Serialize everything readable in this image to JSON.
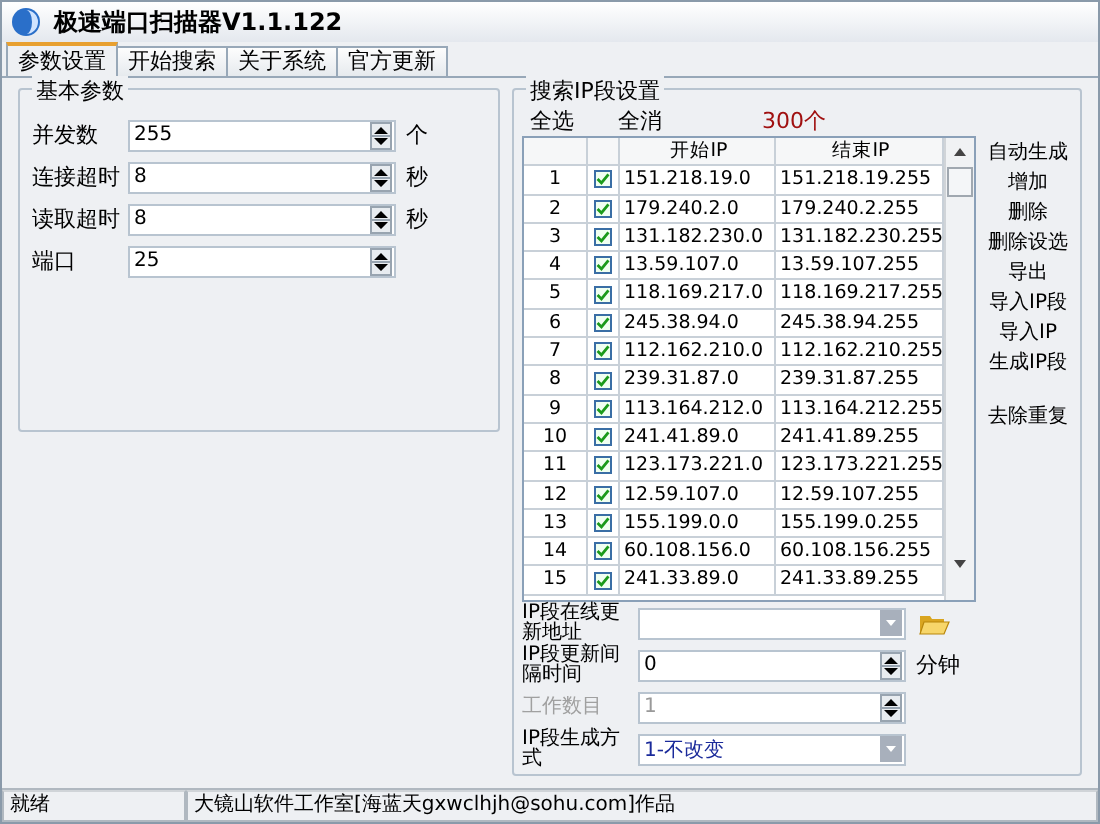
{
  "window": {
    "title": "极速端口扫描器V1.1.122"
  },
  "tabs": [
    {
      "label": "参数设置",
      "selected": true
    },
    {
      "label": "开始搜索",
      "selected": false
    },
    {
      "label": "关于系统",
      "selected": false
    },
    {
      "label": "官方更新",
      "selected": false
    }
  ],
  "basic_params": {
    "title": "基本参数",
    "fields": [
      {
        "label": "并发数",
        "value": "255",
        "unit": "个"
      },
      {
        "label": "连接超时",
        "value": "8",
        "unit": "秒"
      },
      {
        "label": "读取超时",
        "value": "8",
        "unit": "秒"
      },
      {
        "label": "端口",
        "value": "25"
      }
    ]
  },
  "ip_settings": {
    "title": "搜索IP段设置",
    "select_all": "全选",
    "deselect_all": "全消",
    "count": "300个",
    "table": {
      "columns": [
        "开始IP",
        "结束IP"
      ],
      "rows": [
        {
          "index": "1",
          "checked": true,
          "start": "151.218.19.0",
          "end": "151.218.19.255"
        },
        {
          "index": "2",
          "checked": true,
          "start": "179.240.2.0",
          "end": "179.240.2.255"
        },
        {
          "index": "3",
          "checked": true,
          "start": "131.182.230.0",
          "end": "131.182.230.255"
        },
        {
          "index": "4",
          "checked": true,
          "start": "13.59.107.0",
          "end": "13.59.107.255"
        },
        {
          "index": "5",
          "checked": true,
          "start": "118.169.217.0",
          "end": "118.169.217.255"
        },
        {
          "index": "6",
          "checked": true,
          "start": "245.38.94.0",
          "end": "245.38.94.255"
        },
        {
          "index": "7",
          "checked": true,
          "start": "112.162.210.0",
          "end": "112.162.210.255"
        },
        {
          "index": "8",
          "checked": true,
          "start": "239.31.87.0",
          "end": "239.31.87.255"
        },
        {
          "index": "9",
          "checked": true,
          "start": "113.164.212.0",
          "end": "113.164.212.255"
        },
        {
          "index": "10",
          "checked": true,
          "start": "241.41.89.0",
          "end": "241.41.89.255"
        },
        {
          "index": "11",
          "checked": true,
          "start": "123.173.221.0",
          "end": "123.173.221.255"
        },
        {
          "index": "12",
          "checked": true,
          "start": "12.59.107.0",
          "end": "12.59.107.255"
        },
        {
          "index": "13",
          "checked": true,
          "start": "155.199.0.0",
          "end": "155.199.0.255"
        },
        {
          "index": "14",
          "checked": true,
          "start": "60.108.156.0",
          "end": "60.108.156.255"
        },
        {
          "index": "15",
          "checked": true,
          "start": "241.33.89.0",
          "end": "241.33.89.255"
        }
      ]
    },
    "action_groups": [
      [
        "自动生成",
        "增加",
        "删除",
        "删除设选",
        "导出",
        "导入IP段",
        "导入IP",
        "生成IP段"
      ],
      [
        "去除重复"
      ]
    ],
    "fields": [
      {
        "kind": "combo_browse",
        "label": "IP段在线更新地址",
        "disabled": false
      },
      {
        "kind": "spin",
        "label": "IP段更新间隔时间",
        "value": "0",
        "unit": "分钟",
        "disabled": false
      },
      {
        "kind": "spin",
        "label": "工作数目",
        "value": "1",
        "disabled": true
      },
      {
        "kind": "combo",
        "label": "IP段生成方式",
        "value": "1-不改变",
        "disabled": false
      }
    ]
  },
  "status_bar": [
    "就绪",
    "大镜山软件工作室[海蓝天gxwclhjh@sohu.com]作品"
  ]
}
